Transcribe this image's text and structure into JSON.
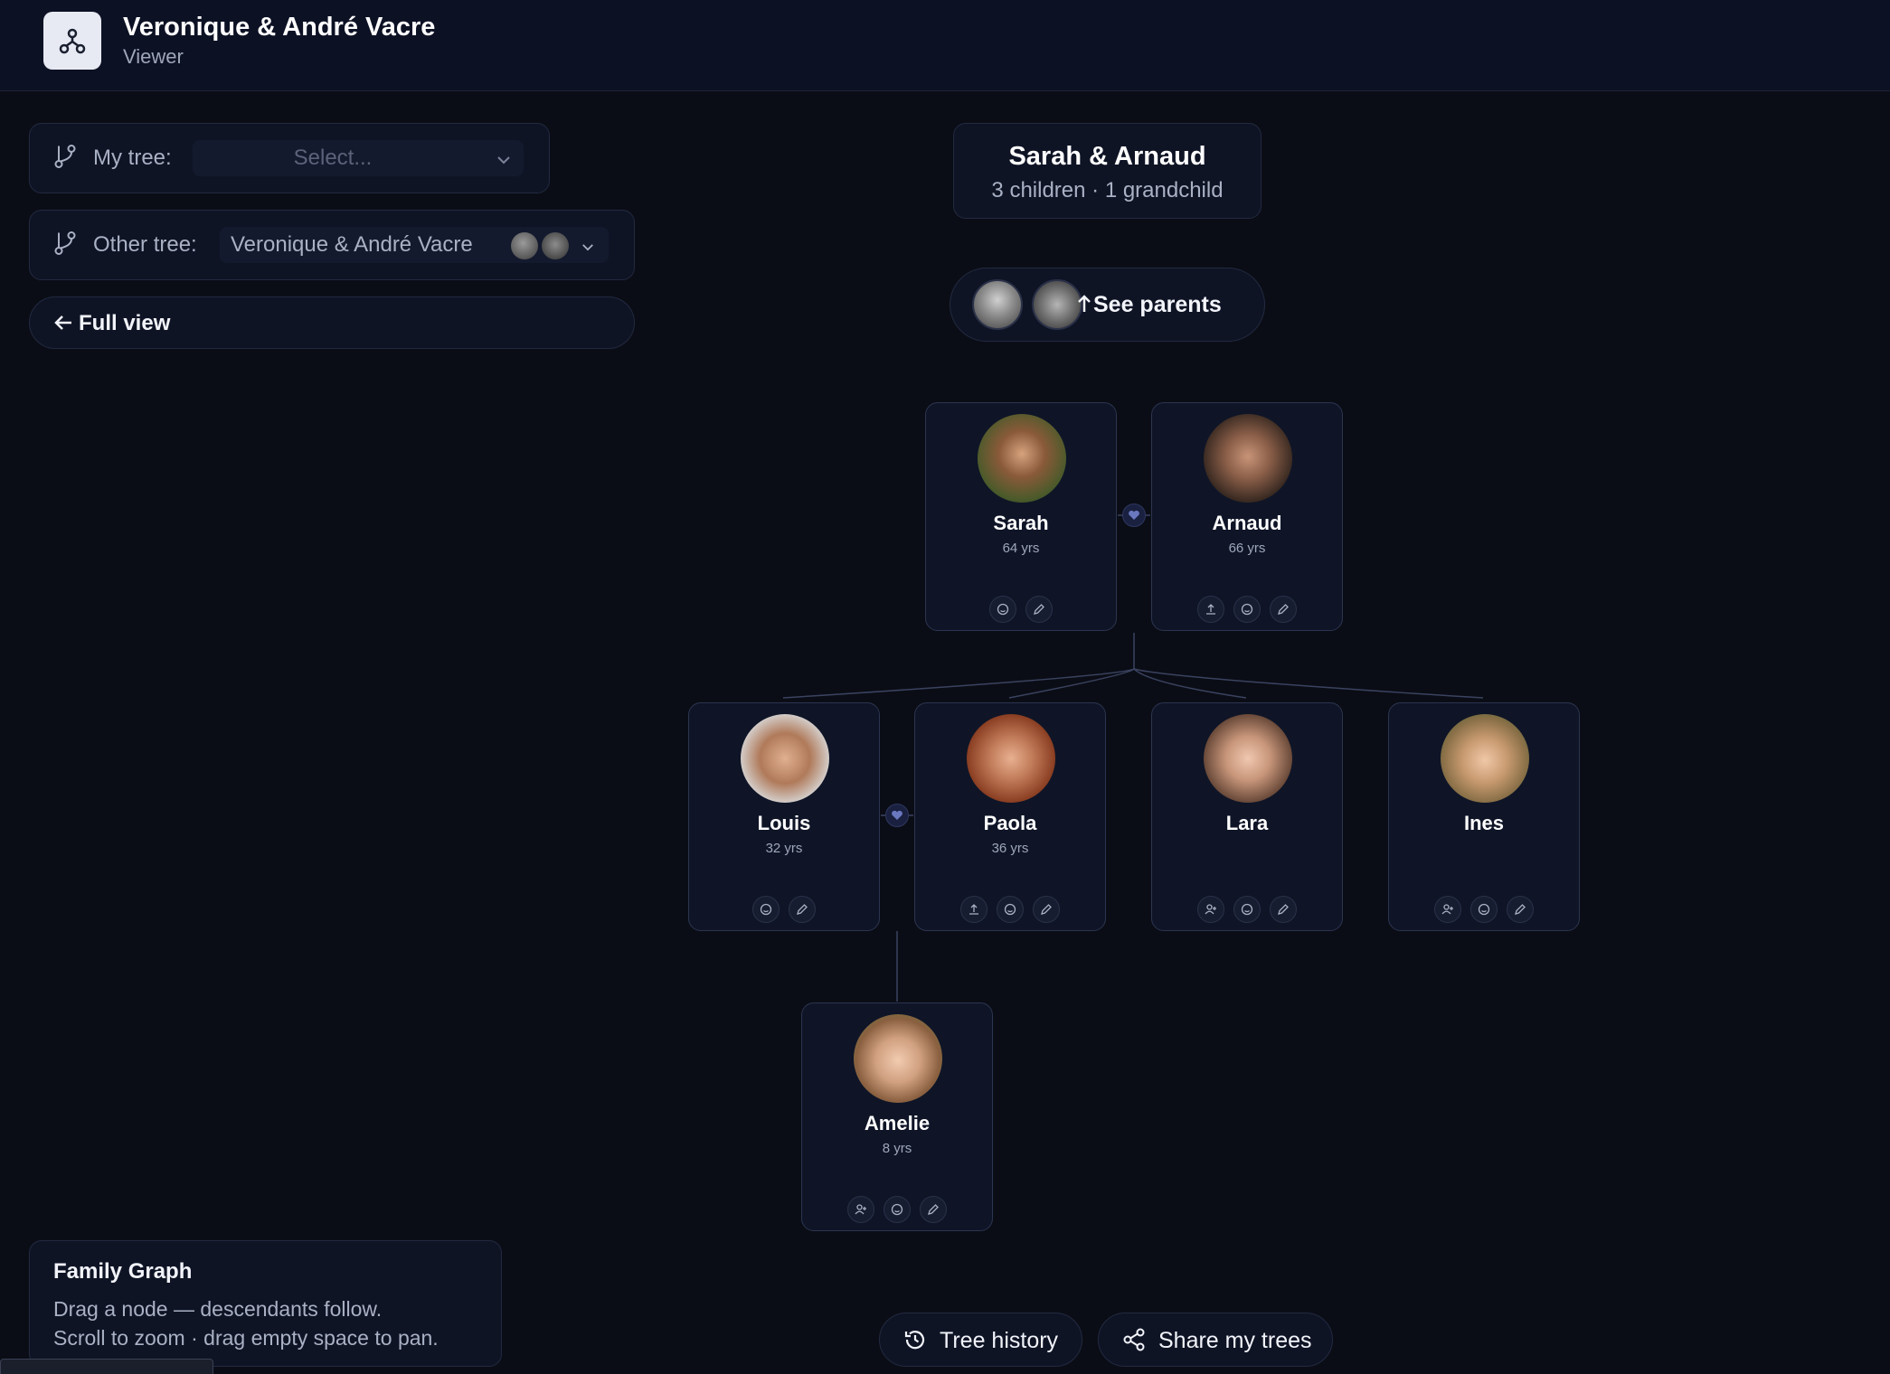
{
  "header": {
    "title": "Veronique & André Vacre",
    "subtitle": "Viewer"
  },
  "my_tree": {
    "label": "My tree:",
    "placeholder": "Select..."
  },
  "other_tree": {
    "label": "Other tree:",
    "value": "Veronique & André Vacre"
  },
  "full_view": {
    "label": "Full view"
  },
  "couple": {
    "title": "Sarah & Arnaud",
    "subtitle": "3 children · 1 grandchild"
  },
  "see_parents": {
    "label": "See parents"
  },
  "people": {
    "sarah": {
      "name": "Sarah",
      "age": "64 yrs"
    },
    "arnaud": {
      "name": "Arnaud",
      "age": "66 yrs"
    },
    "louis": {
      "name": "Louis",
      "age": "32 yrs"
    },
    "paola": {
      "name": "Paola",
      "age": "36 yrs"
    },
    "lara": {
      "name": "Lara",
      "age": ""
    },
    "ines": {
      "name": "Ines",
      "age": ""
    },
    "amelie": {
      "name": "Amelie",
      "age": "8 yrs"
    }
  },
  "info": {
    "title": "Family Graph",
    "line1": "Drag a node — descendants follow.",
    "line2": "Scroll to zoom · drag empty space to pan."
  },
  "buttons": {
    "tree_history": "Tree history",
    "share": "Share my trees"
  },
  "colors": {
    "background": "#0b0d16",
    "card": "#0f1527",
    "border": "#2c3550",
    "accent_heart": "#3b4680"
  }
}
